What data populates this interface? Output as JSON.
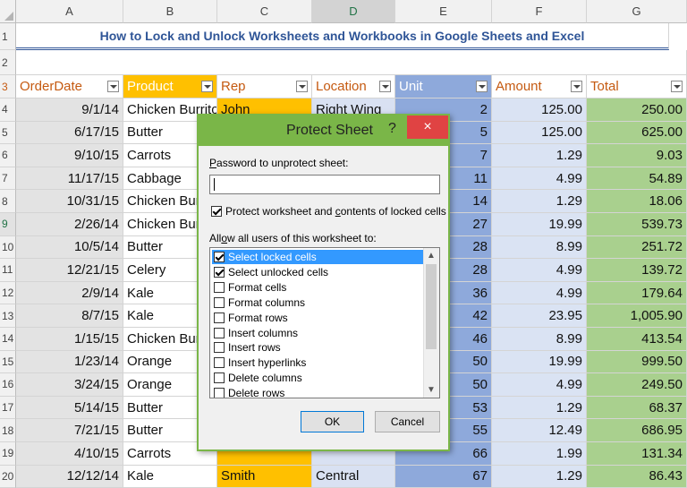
{
  "columns": [
    "A",
    "B",
    "C",
    "D",
    "E",
    "F",
    "G"
  ],
  "title": "How to Lock and Unlock Worksheets and Workbooks in Google Sheets and Excel",
  "headers": [
    "OrderDate",
    "Product",
    "Rep",
    "Location",
    "Unit",
    "Amount",
    "Total"
  ],
  "rows": [
    {
      "n": "4",
      "date": "9/1/14",
      "product": "Chicken Burritos",
      "rep": "John",
      "loc": "Right Wing",
      "unit": "2",
      "amount": "125.00",
      "total": "250.00"
    },
    {
      "n": "5",
      "date": "6/17/15",
      "product": "Butter",
      "rep": "",
      "loc": "",
      "unit": "5",
      "amount": "125.00",
      "total": "625.00"
    },
    {
      "n": "6",
      "date": "9/10/15",
      "product": "Carrots",
      "rep": "",
      "loc": "",
      "unit": "7",
      "amount": "1.29",
      "total": "9.03"
    },
    {
      "n": "7",
      "date": "11/17/15",
      "product": "Cabbage",
      "rep": "",
      "loc": "",
      "unit": "11",
      "amount": "4.99",
      "total": "54.89"
    },
    {
      "n": "8",
      "date": "10/31/15",
      "product": "Chicken Burr",
      "rep": "",
      "loc": "",
      "unit": "14",
      "amount": "1.29",
      "total": "18.06"
    },
    {
      "n": "9",
      "date": "2/26/14",
      "product": "Chicken Burr",
      "rep": "",
      "loc": "",
      "unit": "27",
      "amount": "19.99",
      "total": "539.73"
    },
    {
      "n": "10",
      "date": "10/5/14",
      "product": "Butter",
      "rep": "",
      "loc": "",
      "unit": "28",
      "amount": "8.99",
      "total": "251.72"
    },
    {
      "n": "11",
      "date": "12/21/15",
      "product": "Celery",
      "rep": "",
      "loc": "",
      "unit": "28",
      "amount": "4.99",
      "total": "139.72"
    },
    {
      "n": "12",
      "date": "2/9/14",
      "product": "Kale",
      "rep": "",
      "loc": "",
      "unit": "36",
      "amount": "4.99",
      "total": "179.64"
    },
    {
      "n": "13",
      "date": "8/7/15",
      "product": "Kale",
      "rep": "",
      "loc": "",
      "unit": "42",
      "amount": "23.95",
      "total": "1,005.90"
    },
    {
      "n": "14",
      "date": "1/15/15",
      "product": "Chicken Burr",
      "rep": "",
      "loc": "",
      "unit": "46",
      "amount": "8.99",
      "total": "413.54"
    },
    {
      "n": "15",
      "date": "1/23/14",
      "product": "Orange",
      "rep": "",
      "loc": "",
      "unit": "50",
      "amount": "19.99",
      "total": "999.50"
    },
    {
      "n": "16",
      "date": "3/24/15",
      "product": "Orange",
      "rep": "",
      "loc": "",
      "unit": "50",
      "amount": "4.99",
      "total": "249.50"
    },
    {
      "n": "17",
      "date": "5/14/15",
      "product": "Butter",
      "rep": "",
      "loc": "",
      "unit": "53",
      "amount": "1.29",
      "total": "68.37"
    },
    {
      "n": "18",
      "date": "7/21/15",
      "product": "Butter",
      "rep": "",
      "loc": "",
      "unit": "55",
      "amount": "12.49",
      "total": "686.95"
    },
    {
      "n": "19",
      "date": "4/10/15",
      "product": "Carrots",
      "rep": "",
      "loc": "",
      "unit": "66",
      "amount": "1.99",
      "total": "131.34"
    },
    {
      "n": "20",
      "date": "12/12/14",
      "product": "Kale",
      "rep": "Smith",
      "loc": "Central",
      "unit": "67",
      "amount": "1.29",
      "total": "86.43"
    }
  ],
  "dialog": {
    "title": "Protect Sheet",
    "help": "?",
    "close": "×",
    "password_label_u": "P",
    "password_label_rest": "assword to unprotect sheet:",
    "protect_label_a": "Protect worksheet and ",
    "protect_label_u": "c",
    "protect_label_b": "ontents of locked cells",
    "allow_label_a": "All",
    "allow_label_u": "o",
    "allow_label_b": "w all users of this worksheet to:",
    "options": [
      {
        "label": "Select locked cells",
        "checked": true
      },
      {
        "label": "Select unlocked cells",
        "checked": true
      },
      {
        "label": "Format cells",
        "checked": false
      },
      {
        "label": "Format columns",
        "checked": false
      },
      {
        "label": "Format rows",
        "checked": false
      },
      {
        "label": "Insert columns",
        "checked": false
      },
      {
        "label": "Insert rows",
        "checked": false
      },
      {
        "label": "Insert hyperlinks",
        "checked": false
      },
      {
        "label": "Delete columns",
        "checked": false
      },
      {
        "label": "Delete rows",
        "checked": false
      }
    ],
    "ok": "OK",
    "cancel": "Cancel"
  }
}
